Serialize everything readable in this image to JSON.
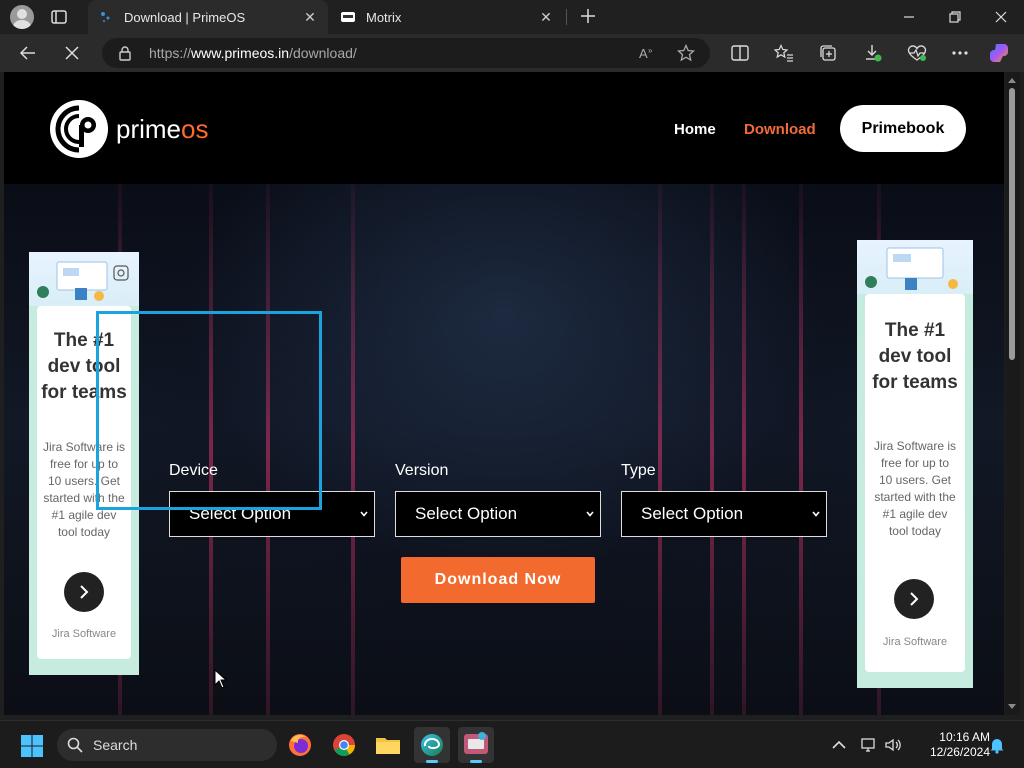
{
  "browser": {
    "tabs": [
      {
        "title": "Download | PrimeOS",
        "active": true
      },
      {
        "title": "Motrix",
        "active": false
      }
    ],
    "address": {
      "scheme": "https://",
      "host": "www.primeos.in",
      "path": "/download/"
    }
  },
  "site": {
    "logo_prime": "prime",
    "logo_os": "os",
    "nav": {
      "home": "Home",
      "download": "Download",
      "primebook": "Primebook"
    },
    "form": {
      "device_label": "Device",
      "device_value": "Select Option",
      "version_label": "Version",
      "version_value": "Select Option",
      "type_label": "Type",
      "type_value": "Select Option",
      "download_button": "Download Now"
    }
  },
  "ads": {
    "left": {
      "title_lines": [
        "The #1",
        "dev tool",
        "for teams"
      ],
      "body_lines": [
        "Jira Software is",
        "free for up to",
        "10 users. Get",
        "started with the",
        "#1 agile dev",
        "tool today"
      ],
      "brand": "Jira Software"
    },
    "right": {
      "title_lines": [
        "The #1",
        "dev tool",
        "for teams"
      ],
      "body_lines": [
        "Jira Software is",
        "free for up to",
        "10 users. Get",
        "started with the",
        "#1 agile dev",
        "tool today"
      ],
      "brand": "Jira Software"
    }
  },
  "taskbar": {
    "search_placeholder": "Search",
    "time": "10:16 AM",
    "date": "12/26/2024"
  },
  "colors": {
    "accent_orange": "#f26a2e",
    "nav_active": "#f26b3a",
    "highlight": "#1aa3dd",
    "ad_bg": "#c6ece0"
  }
}
